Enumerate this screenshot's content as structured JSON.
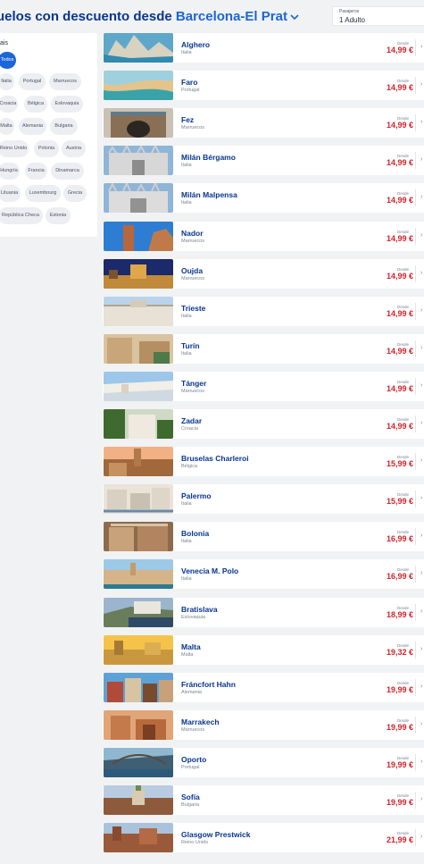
{
  "header": {
    "title_prefix": "uelos con descuento desde",
    "origin": "Barcelona-El Prat"
  },
  "passengers": {
    "label": "Pasajeros",
    "value": "1 Adulto"
  },
  "filter": {
    "title": "ais",
    "chips": [
      "Todos",
      "Italia",
      "Portugal",
      "Marruecos",
      "Croacia",
      "Bélgica",
      "Eslovaquia",
      "Malta",
      "Alemania",
      "Bulgaria",
      "Reino Unido",
      "Polonia",
      "Austria",
      "Hungría",
      "Francia",
      "Dinamarca",
      "Lituania",
      "Luxembourg",
      "Grecia",
      "República Checa",
      "Estonia"
    ],
    "selected": "Todos"
  },
  "price_prefix": "Desde",
  "destinations": [
    {
      "name": "Alghero",
      "country": "Italia",
      "price": "14,99 €"
    },
    {
      "name": "Faro",
      "country": "Portugal",
      "price": "14,99 €"
    },
    {
      "name": "Fez",
      "country": "Marruecos",
      "price": "14,99 €"
    },
    {
      "name": "Milán Bérgamo",
      "country": "Italia",
      "price": "14,99 €"
    },
    {
      "name": "Milán Malpensa",
      "country": "Italia",
      "price": "14,99 €"
    },
    {
      "name": "Nador",
      "country": "Marruecos",
      "price": "14,99 €"
    },
    {
      "name": "Oujda",
      "country": "Marruecos",
      "price": "14,99 €"
    },
    {
      "name": "Trieste",
      "country": "Italia",
      "price": "14,99 €"
    },
    {
      "name": "Turín",
      "country": "Italia",
      "price": "14,99 €"
    },
    {
      "name": "Tánger",
      "country": "Marruecos",
      "price": "14,99 €"
    },
    {
      "name": "Zadar",
      "country": "Croacia",
      "price": "14,99 €"
    },
    {
      "name": "Bruselas Charleroi",
      "country": "Bélgica",
      "price": "15,99 €"
    },
    {
      "name": "Palermo",
      "country": "Italia",
      "price": "15,99 €"
    },
    {
      "name": "Bolonia",
      "country": "Italia",
      "price": "16,99 €"
    },
    {
      "name": "Venecia M. Polo",
      "country": "Italia",
      "price": "16,99 €"
    },
    {
      "name": "Bratislava",
      "country": "Eslovaquia",
      "price": "18,99 €"
    },
    {
      "name": "Malta",
      "country": "Malta",
      "price": "19,32 €"
    },
    {
      "name": "Fráncfort Hahn",
      "country": "Alemania",
      "price": "19,99 €"
    },
    {
      "name": "Marrakech",
      "country": "Marruecos",
      "price": "19,99 €"
    },
    {
      "name": "Oporto",
      "country": "Portugal",
      "price": "19,99 €"
    },
    {
      "name": "Sofía",
      "country": "Bulgaria",
      "price": "19,99 €"
    },
    {
      "name": "Glasgow Prestwick",
      "country": "Reino Unido",
      "price": "21,99 €"
    }
  ],
  "colors": {
    "brand_navy": "#073590",
    "accent_blue": "#1b66d8",
    "price_red": "#d2232a"
  }
}
